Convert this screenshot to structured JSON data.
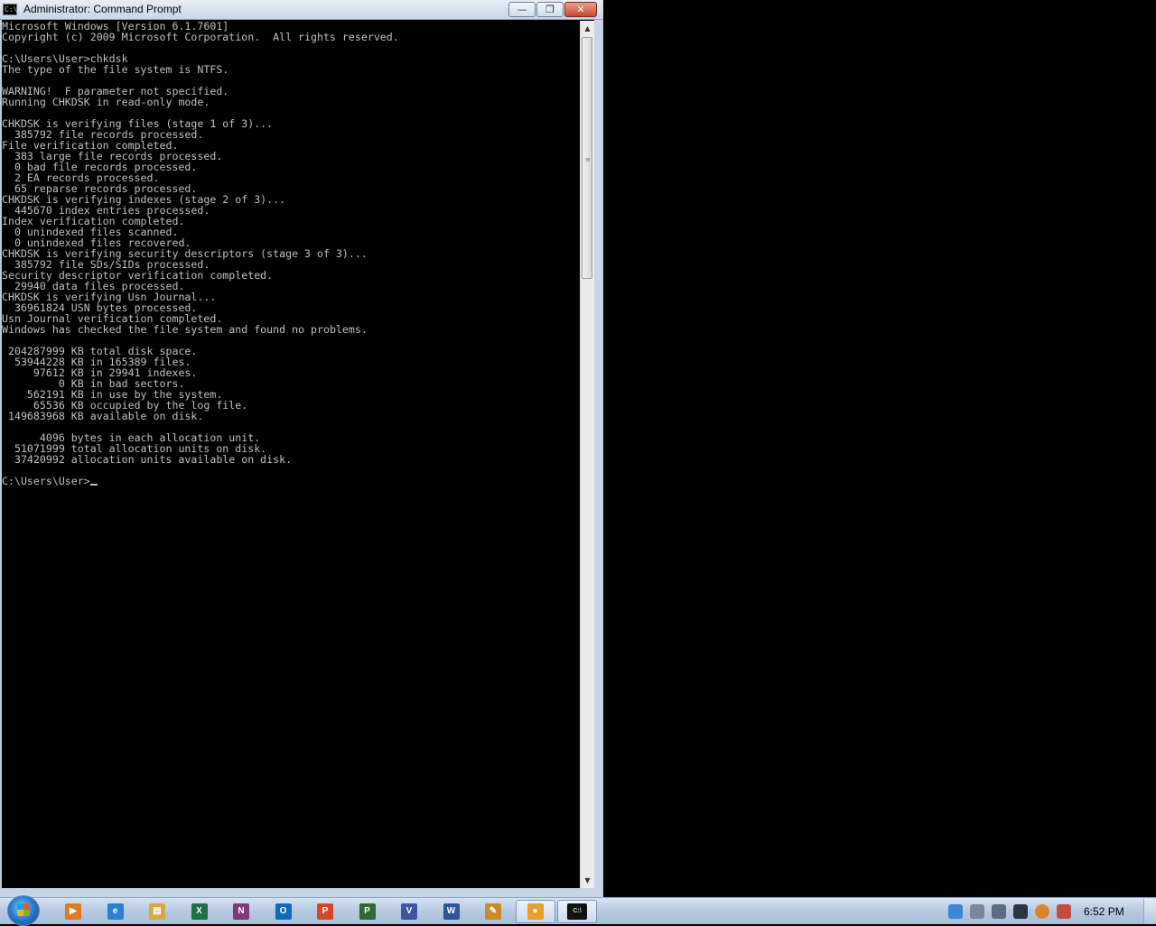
{
  "window": {
    "title": "Administrator: Command Prompt",
    "icon_text": "C:\\",
    "buttons": {
      "minimize": "—",
      "maximize": "❐",
      "close": "✕"
    }
  },
  "console": {
    "lines": [
      "Microsoft Windows [Version 6.1.7601]",
      "Copyright (c) 2009 Microsoft Corporation.  All rights reserved.",
      "",
      "C:\\Users\\User>chkdsk",
      "The type of the file system is NTFS.",
      "",
      "WARNING!  F parameter not specified.",
      "Running CHKDSK in read-only mode.",
      "",
      "CHKDSK is verifying files (stage 1 of 3)...",
      "  385792 file records processed.",
      "File verification completed.",
      "  383 large file records processed.",
      "  0 bad file records processed.",
      "  2 EA records processed.",
      "  65 reparse records processed.",
      "CHKDSK is verifying indexes (stage 2 of 3)...",
      "  445670 index entries processed.",
      "Index verification completed.",
      "  0 unindexed files scanned.",
      "  0 unindexed files recovered.",
      "CHKDSK is verifying security descriptors (stage 3 of 3)...",
      "  385792 file SDs/SIDs processed.",
      "Security descriptor verification completed.",
      "  29940 data files processed.",
      "CHKDSK is verifying Usn Journal...",
      "  36961824 USN bytes processed.",
      "Usn Journal verification completed.",
      "Windows has checked the file system and found no problems.",
      "",
      " 204287999 KB total disk space.",
      "  53944228 KB in 165389 files.",
      "     97612 KB in 29941 indexes.",
      "         0 KB in bad sectors.",
      "    562191 KB in use by the system.",
      "     65536 KB occupied by the log file.",
      " 149683968 KB available on disk.",
      "",
      "      4096 bytes in each allocation unit.",
      "  51071999 total allocation units on disk.",
      "  37420992 allocation units available on disk.",
      ""
    ],
    "prompt": "C:\\Users\\User>"
  },
  "scrollbar": {
    "up_arrow": "▲",
    "down_arrow": "▼",
    "grip": "≡"
  },
  "taskbar": {
    "apps": [
      {
        "name": "media-player",
        "label": "▶",
        "color": "#e07a1f",
        "active": false
      },
      {
        "name": "internet-explorer",
        "label": "e",
        "color": "#2a7fd4",
        "active": false
      },
      {
        "name": "file-explorer",
        "label": "▤",
        "color": "#d9a93b",
        "active": false
      },
      {
        "name": "excel",
        "label": "X",
        "color": "#1e7145",
        "active": false
      },
      {
        "name": "onenote",
        "label": "N",
        "color": "#80397b",
        "active": false
      },
      {
        "name": "outlook",
        "label": "O",
        "color": "#0f6cbd",
        "active": false
      },
      {
        "name": "powerpoint",
        "label": "P",
        "color": "#d24726",
        "active": false
      },
      {
        "name": "project",
        "label": "P",
        "color": "#2f6a31",
        "active": false
      },
      {
        "name": "visio",
        "label": "V",
        "color": "#3955a3",
        "active": false
      },
      {
        "name": "word",
        "label": "W",
        "color": "#2b579a",
        "active": false
      },
      {
        "name": "paint",
        "label": "✎",
        "color": "#c98b2a",
        "active": false
      },
      {
        "name": "chrome",
        "label": "●",
        "color": "#e8a12a",
        "active": true
      },
      {
        "name": "command-prompt",
        "label": "C:\\",
        "color": "#111111",
        "active": true
      }
    ],
    "clock": "6:52 PM"
  }
}
